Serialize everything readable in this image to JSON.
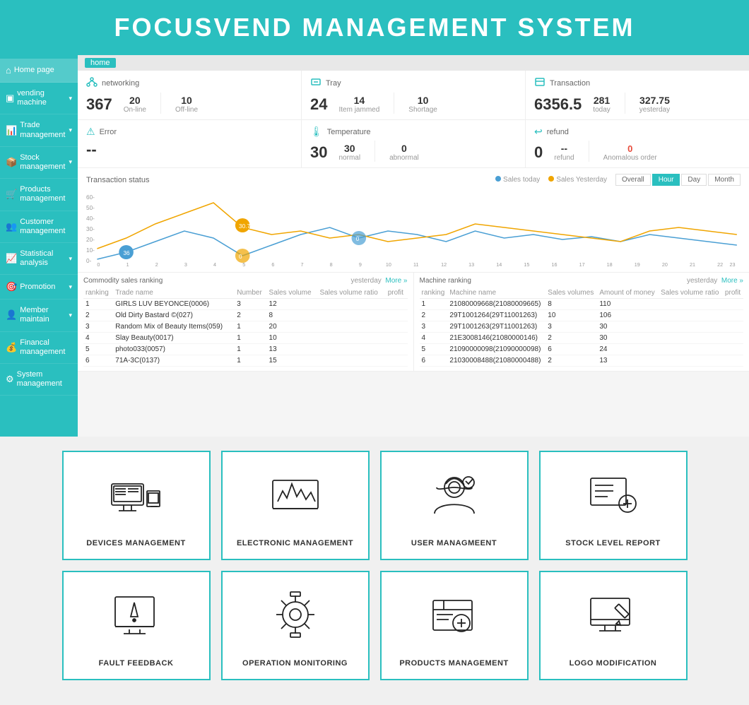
{
  "header": {
    "title": "FOCUSVEND MANAGEMENT SYSTEM"
  },
  "sidebar": {
    "items": [
      {
        "label": "Home page",
        "icon": "🏠",
        "active": true,
        "hasChevron": false
      },
      {
        "label": "vending machine",
        "icon": "🖥",
        "active": false,
        "hasChevron": true
      },
      {
        "label": "Trade management",
        "icon": "📊",
        "active": false,
        "hasChevron": true
      },
      {
        "label": "Stock management",
        "icon": "📦",
        "active": false,
        "hasChevron": true
      },
      {
        "label": "Products management",
        "icon": "🛒",
        "active": false,
        "hasChevron": false
      },
      {
        "label": "Customer management",
        "icon": "👥",
        "active": false,
        "hasChevron": false
      },
      {
        "label": "Statistical analysis",
        "icon": "📈",
        "active": false,
        "hasChevron": true
      },
      {
        "label": "Promotion",
        "icon": "🎯",
        "active": false,
        "hasChevron": true
      },
      {
        "label": "Member maintain",
        "icon": "👤",
        "active": false,
        "hasChevron": true
      },
      {
        "label": "Financal management",
        "icon": "💰",
        "active": false,
        "hasChevron": false
      },
      {
        "label": "System management",
        "icon": "⚙",
        "active": false,
        "hasChevron": false
      }
    ]
  },
  "breadcrumb": {
    "home_label": "home"
  },
  "networking": {
    "label": "networking",
    "main_number": "367",
    "sub1_label": "On-line",
    "sub1_value": "20",
    "sub2_label": "Off-line",
    "sub2_value": "10"
  },
  "tray": {
    "label": "Tray",
    "main_number": "24",
    "sub1_label": "Item jammed",
    "sub1_value": "14",
    "sub2_label": "Shortage",
    "sub2_value": "10"
  },
  "transaction": {
    "label": "Transaction",
    "main_number": "6356.5",
    "sub1_label": "today",
    "sub1_value": "281",
    "sub2_label": "yesterday",
    "sub2_value": "327.75"
  },
  "error": {
    "label": "Error",
    "value": "--"
  },
  "temperature": {
    "label": "Temperature",
    "main_number": "30",
    "sub1_label": "normal",
    "sub1_value": "30",
    "sub2_label": "abnormal",
    "sub2_value": "0"
  },
  "refund": {
    "label": "refund",
    "main_number": "0",
    "sub1_label": "refund",
    "sub1_value": "--",
    "sub2_label": "Anomalous order",
    "sub2_value": "0"
  },
  "chart": {
    "title": "Transaction status",
    "legend_today": "Sales today",
    "legend_yesterday": "Sales Yesterday",
    "tabs": [
      "Overall",
      "Hour",
      "Day",
      "Month"
    ],
    "active_tab": "Hour"
  },
  "commodity_table": {
    "title": "Commodity sales ranking",
    "yesterday_label": "yesterday",
    "more_label": "More »",
    "columns": [
      "ranking",
      "Trade name",
      "Number",
      "Sales volume",
      "Sales volume ratio",
      "profit"
    ],
    "rows": [
      [
        "1",
        "GIRLS LUV BEYONCE(0006)",
        "3",
        "12",
        "",
        ""
      ],
      [
        "2",
        "Old Dirty Bastard ©(027)",
        "2",
        "8",
        "",
        ""
      ],
      [
        "3",
        "Random Mix of Beauty Items(059)",
        "1",
        "20",
        "",
        ""
      ],
      [
        "4",
        "Slay Beauty(0017)",
        "1",
        "10",
        "",
        ""
      ],
      [
        "5",
        "photo033(0057)",
        "1",
        "13",
        "",
        ""
      ],
      [
        "6",
        "71A-3C(0137)",
        "1",
        "15",
        "",
        ""
      ]
    ]
  },
  "machine_table": {
    "title": "Machine ranking",
    "yesterday_label": "yesterday",
    "more_label": "More »",
    "columns": [
      "ranking",
      "Machine name",
      "Sales volumes",
      "Amount of money",
      "Sales volume ratio",
      "profit"
    ],
    "rows": [
      [
        "1",
        "21080009668(21080009665)",
        "8",
        "110",
        "",
        ""
      ],
      [
        "2",
        "29T1001264(29T11001263)",
        "10",
        "106",
        "",
        ""
      ],
      [
        "3",
        "29T1001263(29T11001263)",
        "3",
        "30",
        "",
        ""
      ],
      [
        "4",
        "21E3008146(21080000146)",
        "2",
        "30",
        "",
        ""
      ],
      [
        "5",
        "21090000098(21090000098)",
        "6",
        "24",
        "",
        ""
      ],
      [
        "6",
        "21030008488(21080000488)",
        "2",
        "13",
        "",
        ""
      ]
    ]
  },
  "cards_row1": [
    {
      "id": "devices",
      "label": "DEVICES MANAGEMENT",
      "icon_type": "devices"
    },
    {
      "id": "electronic",
      "label": "ELECTRONIC MANAGEMENT",
      "icon_type": "electronic"
    },
    {
      "id": "user",
      "label": "USER MANAGMEENT",
      "icon_type": "user"
    },
    {
      "id": "stock",
      "label": "STOCK LEVEL REPORT",
      "icon_type": "stock"
    }
  ],
  "cards_row2": [
    {
      "id": "fault",
      "label": "FAULT FEEDBACK",
      "icon_type": "fault"
    },
    {
      "id": "operation",
      "label": "OPERATION MONITORING",
      "icon_type": "operation"
    },
    {
      "id": "products",
      "label": "PRODUCTS MANAGEMENT",
      "icon_type": "products"
    },
    {
      "id": "logo",
      "label": "LOGO MODIFICATION",
      "icon_type": "logo"
    }
  ],
  "colors": {
    "teal": "#2abfbf",
    "accent_blue": "#4a9fd4",
    "accent_orange": "#f0a500"
  }
}
